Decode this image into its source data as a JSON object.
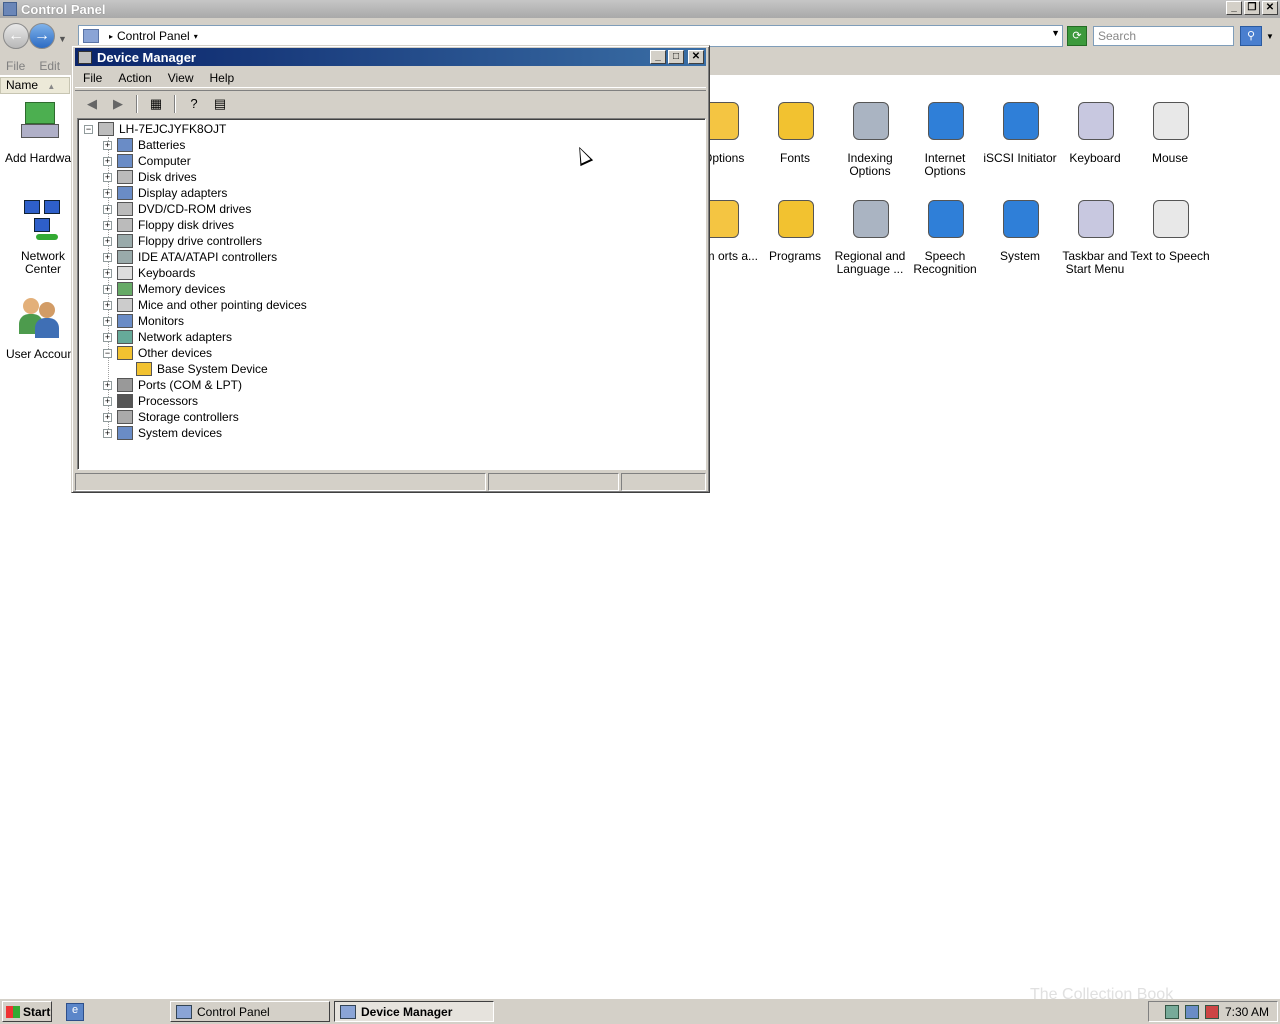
{
  "control_panel": {
    "title": "Control Panel",
    "breadcrumb": "Control Panel",
    "search_placeholder": "Search",
    "menu": [
      "File",
      "Edit"
    ],
    "column_header": "Name",
    "items_left": [
      {
        "label": "Add Hardwar",
        "icon": "add-hardware-icon"
      },
      {
        "label": "Network Center",
        "icon": "network-center-icon"
      },
      {
        "label": "User Accoun",
        "icon": "user-accounts-icon"
      }
    ],
    "items_row1": [
      {
        "label": "r Options",
        "icon": "folder-options-icon"
      },
      {
        "label": "Fonts",
        "icon": "fonts-icon"
      },
      {
        "label": "Indexing Options",
        "icon": "indexing-options-icon"
      },
      {
        "label": "Internet Options",
        "icon": "internet-options-icon"
      },
      {
        "label": "iSCSI Initiator",
        "icon": "iscsi-initiator-icon"
      },
      {
        "label": "Keyboard",
        "icon": "keyboard-icon"
      },
      {
        "label": "Mouse",
        "icon": "mouse-icon"
      }
    ],
    "items_row2": [
      {
        "label": "oblem orts a...",
        "icon": "problem-reports-icon"
      },
      {
        "label": "Programs",
        "icon": "programs-icon"
      },
      {
        "label": "Regional and Language ...",
        "icon": "regional-language-icon"
      },
      {
        "label": "Speech Recognition",
        "icon": "speech-recognition-icon"
      },
      {
        "label": "System",
        "icon": "system-icon"
      },
      {
        "label": "Taskbar and Start Menu",
        "icon": "taskbar-start-menu-icon"
      },
      {
        "label": "Text to Speech",
        "icon": "text-to-speech-icon"
      }
    ]
  },
  "device_manager": {
    "title": "Device Manager",
    "menu": [
      "File",
      "Action",
      "View",
      "Help"
    ],
    "root": "LH-7EJCJYFK8OJT",
    "nodes": [
      {
        "label": "Batteries",
        "icon": "battery-icon",
        "expand": "+"
      },
      {
        "label": "Computer",
        "icon": "computer-icon",
        "expand": "+"
      },
      {
        "label": "Disk drives",
        "icon": "disk-drive-icon",
        "expand": "+"
      },
      {
        "label": "Display adapters",
        "icon": "display-adapter-icon",
        "expand": "+"
      },
      {
        "label": "DVD/CD-ROM drives",
        "icon": "dvd-drive-icon",
        "expand": "+"
      },
      {
        "label": "Floppy disk drives",
        "icon": "floppy-drive-icon",
        "expand": "+"
      },
      {
        "label": "Floppy drive controllers",
        "icon": "floppy-controller-icon",
        "expand": "+"
      },
      {
        "label": "IDE ATA/ATAPI controllers",
        "icon": "ide-controller-icon",
        "expand": "+"
      },
      {
        "label": "Keyboards",
        "icon": "keyboard-icon",
        "expand": "+"
      },
      {
        "label": "Memory devices",
        "icon": "memory-icon",
        "expand": "+"
      },
      {
        "label": "Mice and other pointing devices",
        "icon": "mouse-icon",
        "expand": "+"
      },
      {
        "label": "Monitors",
        "icon": "monitor-icon",
        "expand": "+"
      },
      {
        "label": "Network adapters",
        "icon": "network-adapter-icon",
        "expand": "+"
      },
      {
        "label": "Other devices",
        "icon": "unknown-device-icon",
        "expand": "−"
      },
      {
        "label": "Ports (COM & LPT)",
        "icon": "port-icon",
        "expand": "+"
      },
      {
        "label": "Processors",
        "icon": "processor-icon",
        "expand": "+"
      },
      {
        "label": "Storage controllers",
        "icon": "storage-controller-icon",
        "expand": "+"
      },
      {
        "label": "System devices",
        "icon": "system-device-icon",
        "expand": "+"
      }
    ],
    "child_of_other_devices": {
      "label": "Base System Device",
      "icon": "warning-device-icon"
    }
  },
  "taskbar": {
    "start_label": "Start",
    "tasks": [
      "Control Panel",
      "Device Manager"
    ],
    "clock": "7:30 AM",
    "watermark": "The Collection Book"
  },
  "colors": {
    "active_title": "#0a246a",
    "inactive_title": "#a9a9a9",
    "face": "#d4d0c8"
  }
}
